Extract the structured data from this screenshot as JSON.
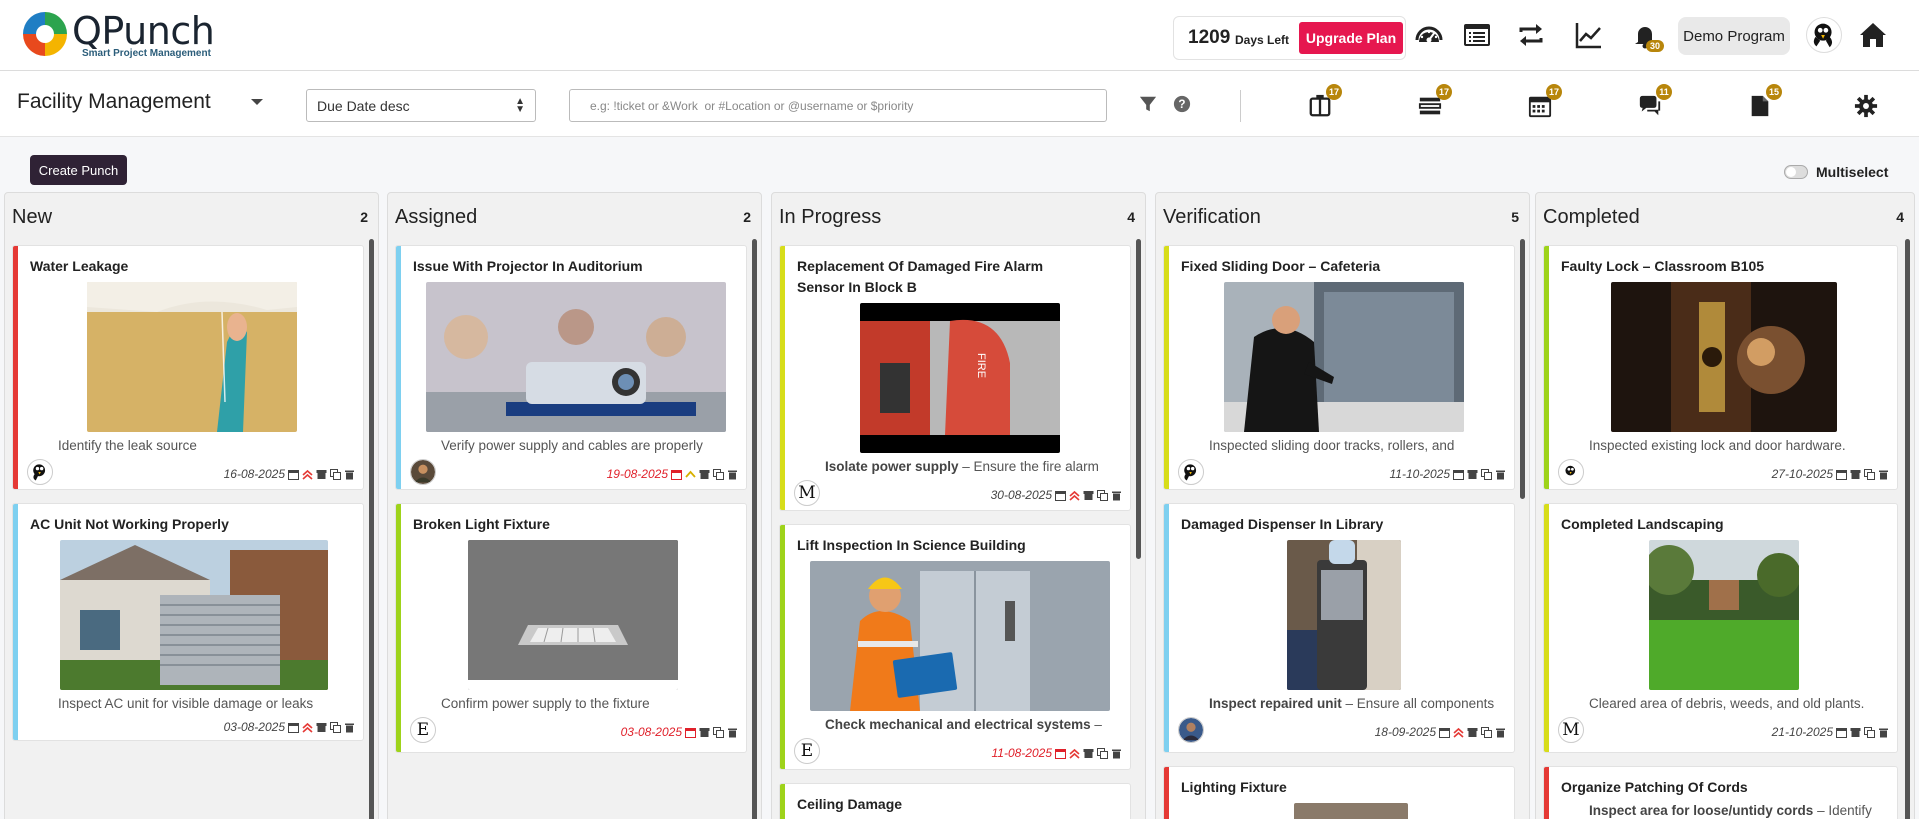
{
  "header": {
    "logo_text": "QPunch",
    "logo_subtitle": "Smart Project Management",
    "days_left_number": "1209",
    "days_left_label": "Days Left",
    "upgrade_label": "Upgrade Plan",
    "notifications_count": "30",
    "program_label": "Demo Program"
  },
  "toolbar": {
    "project_name": "Facility Management",
    "sort_value": "Due Date desc",
    "search_placeholder": "e.g: !ticket or &Work  or #Location or @username or $priority",
    "badges": {
      "board": "17",
      "list": "17",
      "calendar": "17",
      "chat": "11",
      "docs": "15"
    }
  },
  "actions": {
    "create_label": "Create Punch",
    "multiselect_label": "Multiselect"
  },
  "colors": {
    "accent_dark": "#2f2235",
    "upgrade": "#e6174f",
    "badge": "#b8860b",
    "high": "#e53935",
    "medium": "#7ed0f0",
    "low": "#9ed31a",
    "yellow": "#d7dd1a"
  },
  "columns": [
    {
      "title": "New",
      "count": "2",
      "cards": [
        {
          "title": "Water Leakage",
          "bullet": "Identify the leak source",
          "date": "16-08-2025",
          "avatar": ""
        },
        {
          "title": "AC Unit Not Working Properly",
          "bullet": "Inspect AC unit for visible damage or leaks",
          "date": "03-08-2025",
          "avatar": ""
        }
      ]
    },
    {
      "title": "Assigned",
      "count": "2",
      "cards": [
        {
          "title": "Issue With Projector In Auditorium",
          "bullet": "Verify power supply and cables are properly",
          "date": "19-08-2025",
          "avatar": ""
        },
        {
          "title": "Broken Light Fixture",
          "bullet": "Confirm power supply to the fixture",
          "date": "03-08-2025",
          "avatar": "E"
        }
      ]
    },
    {
      "title": "In Progress",
      "count": "4",
      "cards": [
        {
          "title": "Replacement Of Damaged Fire Alarm Sensor In Block B",
          "bullet_bold": "Isolate power supply",
          "bullet_rest": " – Ensure the fire alarm",
          "date": "30-08-2025",
          "avatar": "M"
        },
        {
          "title": "Lift Inspection In Science Building",
          "bullet_bold": "Check mechanical and electrical systems",
          "bullet_rest": " –",
          "date": "11-08-2025",
          "avatar": "E"
        },
        {
          "title": "Ceiling Damage"
        }
      ]
    },
    {
      "title": "Verification",
      "count": "5",
      "cards": [
        {
          "title": "Fixed Sliding Door – Cafeteria",
          "bullet": "Inspected sliding door tracks, rollers, and",
          "date": "11-10-2025",
          "avatar": ""
        },
        {
          "title": "Damaged Dispenser In Library",
          "bullet_bold": "Inspect repaired unit",
          "bullet_rest": " – Ensure all components",
          "date": "18-09-2025",
          "avatar": ""
        },
        {
          "title": "Lighting Fixture"
        }
      ]
    },
    {
      "title": "Completed",
      "count": "4",
      "cards": [
        {
          "title": "Faulty Lock – Classroom B105",
          "bullet": "Inspected existing lock and door hardware.",
          "date": "27-10-2025",
          "avatar": ""
        },
        {
          "title": "Completed Landscaping",
          "bullet": "Cleared area of debris, weeds, and old plants.",
          "date": "21-10-2025",
          "avatar": "M"
        },
        {
          "title": "Organize Patching Of Cords",
          "bullet_bold": "Inspect area for loose/untidy cords",
          "bullet_rest": " – Identify"
        }
      ]
    }
  ]
}
